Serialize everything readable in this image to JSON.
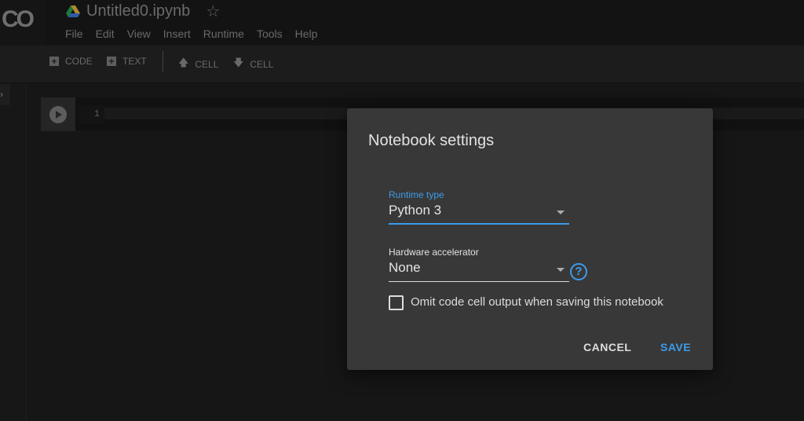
{
  "app": {
    "logo": "CO",
    "title": "Untitled0.ipynb"
  },
  "menu": [
    "File",
    "Edit",
    "View",
    "Insert",
    "Runtime",
    "Tools",
    "Help"
  ],
  "toolbar": {
    "code": "CODE",
    "text": "TEXT",
    "cell_up": "CELL",
    "cell_down": "CELL"
  },
  "cell": {
    "line_number": "1"
  },
  "dialog": {
    "title": "Notebook settings",
    "runtime_label": "Runtime type",
    "runtime_value": "Python 3",
    "accelerator_label": "Hardware accelerator",
    "accelerator_value": "None",
    "omit_label": "Omit code cell output when saving this notebook",
    "omit_checked": false,
    "cancel": "CANCEL",
    "save": "SAVE"
  },
  "colors": {
    "accent": "#3d9be9",
    "dialog_bg": "#383838"
  }
}
